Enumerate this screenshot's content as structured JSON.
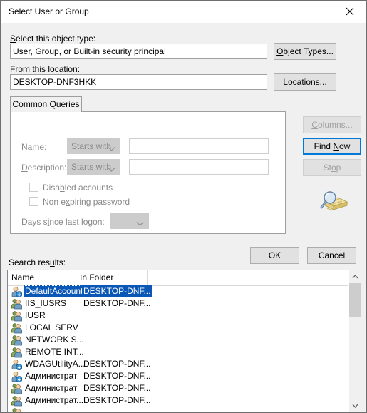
{
  "window": {
    "title": "Select User or Group",
    "close_icon": "close-icon"
  },
  "object_type": {
    "label": "Select this object type:",
    "label_accesskey": "S",
    "value": "User, Group, or Built-in security principal",
    "button": "Object Types...",
    "button_accesskey": "O"
  },
  "location": {
    "label": "From this location:",
    "label_accesskey": "F",
    "value": "DESKTOP-DNF3HKK",
    "button": "Locations...",
    "button_accesskey": "L"
  },
  "tabs": [
    {
      "label": "Common Queries",
      "selected": true
    }
  ],
  "query": {
    "name_label": "Name:",
    "name_accesskey": "a",
    "name_condition": "Starts with",
    "name_value": "",
    "description_label": "Description:",
    "description_accesskey": "D",
    "description_condition": "Starts with",
    "description_value": "",
    "disabled_accounts_label": "Disabled accounts",
    "disabled_accounts_accesskey": "b",
    "disabled_accounts_checked": false,
    "non_expiring_label": "Non expiring password",
    "non_expiring_accesskey": "x",
    "non_expiring_checked": false,
    "days_label": "Days since last logon:",
    "days_accesskey": "i",
    "days_value": ""
  },
  "side_buttons": {
    "columns": "Columns...",
    "columns_accesskey": "C",
    "columns_disabled": true,
    "find_now": "Find Now",
    "find_now_accesskey": "N",
    "find_now_focused": true,
    "stop": "Stop",
    "stop_accesskey": "o",
    "stop_disabled": true,
    "decoration_icon": "search-folder-icon"
  },
  "dialog_buttons": {
    "ok": "OK",
    "cancel": "Cancel"
  },
  "results": {
    "label": "Search results:",
    "label_accesskey": "u",
    "columns": [
      "Name",
      "In Folder"
    ],
    "rows": [
      {
        "icon": "user-icon",
        "name": "DefaultAccount",
        "folder": "DESKTOP-DNF...",
        "selected": true
      },
      {
        "icon": "group-icon",
        "name": "IIS_IUSRS",
        "folder": "DESKTOP-DNF...",
        "selected": false
      },
      {
        "icon": "group-icon",
        "name": "IUSR",
        "folder": "",
        "selected": false
      },
      {
        "icon": "group-icon",
        "name": "LOCAL SERV",
        "folder": "",
        "selected": false
      },
      {
        "icon": "group-icon",
        "name": "NETWORK S...",
        "folder": "",
        "selected": false
      },
      {
        "icon": "group-icon",
        "name": "REMOTE INT...",
        "folder": "",
        "selected": false
      },
      {
        "icon": "user-icon",
        "name": "WDAGUtilityA...",
        "folder": "DESKTOP-DNF...",
        "selected": false
      },
      {
        "icon": "user-icon",
        "name": "Администрат",
        "folder": "DESKTOP-DNF...",
        "selected": false
      },
      {
        "icon": "group-icon",
        "name": "Администрат",
        "folder": "DESKTOP-DNF...",
        "selected": false
      },
      {
        "icon": "group-icon",
        "name": "Администрат...",
        "folder": "DESKTOP-DNF...",
        "selected": false
      }
    ]
  },
  "colors": {
    "dialog_background": "#f0f0f0",
    "selection_blue": "#0b57b5",
    "focus_blue": "#0078d7",
    "disabled_text": "#898989",
    "border": "#a0a0a0"
  }
}
